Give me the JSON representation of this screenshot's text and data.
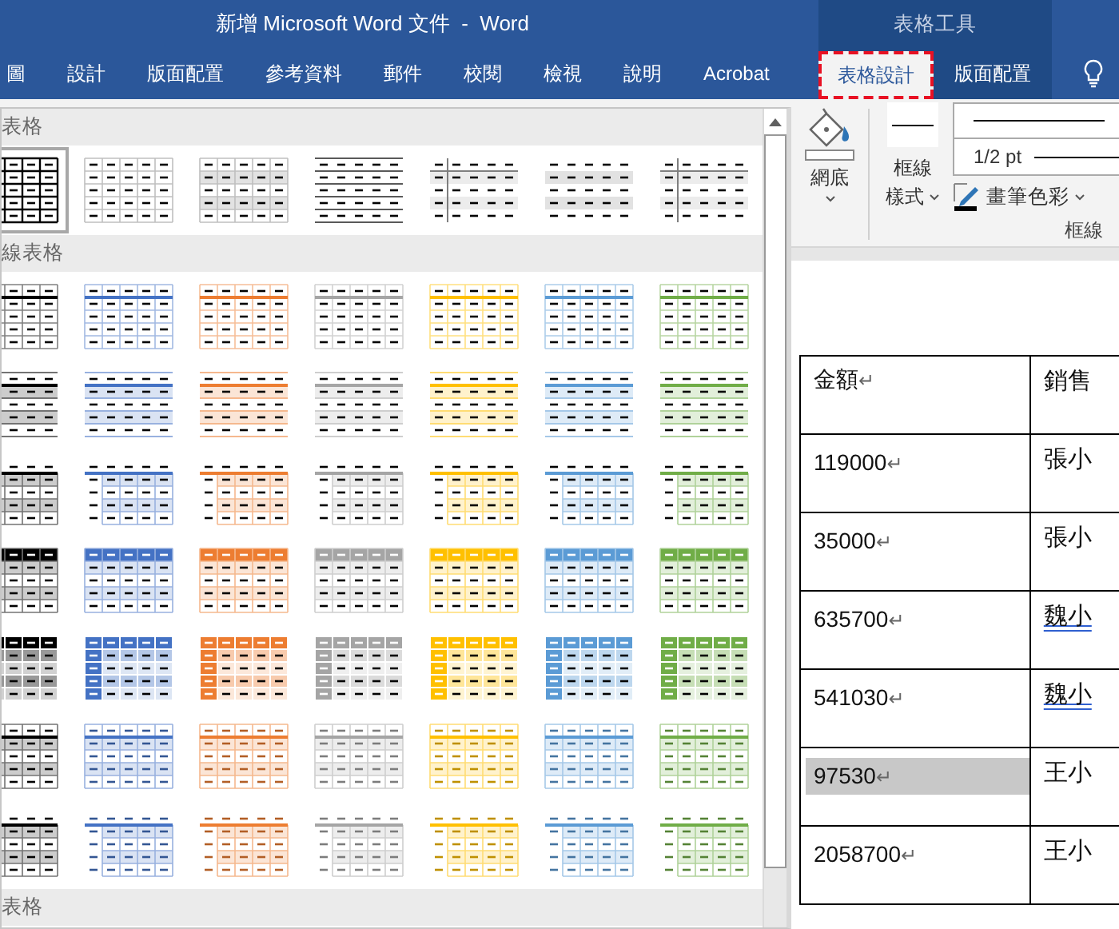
{
  "window": {
    "title": "新增 Microsoft Word 文件  -  Word"
  },
  "ribbon_tabs": [
    {
      "label": "圖",
      "selected": false
    },
    {
      "label": "設計",
      "selected": false
    },
    {
      "label": "版面配置",
      "selected": false
    },
    {
      "label": "參考資料",
      "selected": false
    },
    {
      "label": "郵件",
      "selected": false
    },
    {
      "label": "校閱",
      "selected": false
    },
    {
      "label": "檢視",
      "selected": false
    },
    {
      "label": "說明",
      "selected": false
    },
    {
      "label": "Acrobat",
      "selected": false
    }
  ],
  "contextual_group": {
    "label": "表格工具",
    "tabs": [
      {
        "label": "表格設計",
        "selected": true
      },
      {
        "label": "版面配置",
        "selected": false
      }
    ]
  },
  "gallery": {
    "sections": [
      {
        "label": "表格",
        "rows": [
          {
            "items": [
              {
                "kind": "grid-bold",
                "selected": true
              },
              {
                "kind": "grid",
                "selected": false
              },
              {
                "kind": "grid-banded",
                "selected": false
              },
              {
                "kind": "lines",
                "selected": false
              },
              {
                "kind": "plain-header-col",
                "selected": false
              },
              {
                "kind": "plain-banded",
                "selected": false
              },
              {
                "kind": "plain-header-col",
                "selected": false
              }
            ]
          }
        ]
      },
      {
        "label": "線表格",
        "rows": [
          {
            "kind": "light",
            "items": [
              {
                "color": "#000000",
                "selected": false
              },
              {
                "color": "#4472c4",
                "selected": false
              },
              {
                "color": "#ed7d31",
                "selected": false
              },
              {
                "color": "#a5a5a5",
                "selected": false
              },
              {
                "color": "#ffc000",
                "selected": false
              },
              {
                "color": "#5b9bd5",
                "selected": false
              },
              {
                "color": "#70ad47",
                "selected": false
              }
            ]
          },
          {
            "kind": "banded",
            "items": [
              {
                "color": "#000000",
                "selected": false
              },
              {
                "color": "#4472c4",
                "selected": false
              },
              {
                "color": "#ed7d31",
                "selected": false
              },
              {
                "color": "#a5a5a5",
                "selected": false
              },
              {
                "color": "#ffc000",
                "selected": false
              },
              {
                "color": "#5b9bd5",
                "selected": false
              },
              {
                "color": "#70ad47",
                "selected": false
              }
            ]
          },
          {
            "kind": "open",
            "items": [
              {
                "color": "#000000",
                "selected": false
              },
              {
                "color": "#4472c4",
                "selected": false
              },
              {
                "color": "#ed7d31",
                "selected": false
              },
              {
                "color": "#a5a5a5",
                "selected": false
              },
              {
                "color": "#ffc000",
                "selected": false
              },
              {
                "color": "#5b9bd5",
                "selected": false
              },
              {
                "color": "#70ad47",
                "selected": false
              }
            ]
          },
          {
            "kind": "header",
            "items": [
              {
                "color": "#000000",
                "selected": false
              },
              {
                "color": "#4472c4",
                "selected": false
              },
              {
                "color": "#ed7d31",
                "selected": false
              },
              {
                "color": "#a5a5a5",
                "selected": false
              },
              {
                "color": "#ffc000",
                "selected": false
              },
              {
                "color": "#5b9bd5",
                "selected": false
              },
              {
                "color": "#70ad47",
                "selected": false
              }
            ]
          },
          {
            "kind": "dark",
            "items": [
              {
                "color": "#000000",
                "selected": false
              },
              {
                "color": "#4472c4",
                "selected": false
              },
              {
                "color": "#ed7d31",
                "selected": false
              },
              {
                "color": "#a5a5a5",
                "selected": false
              },
              {
                "color": "#ffc000",
                "selected": false
              },
              {
                "color": "#5b9bd5",
                "selected": false
              },
              {
                "color": "#70ad47",
                "selected": false
              }
            ]
          },
          {
            "kind": "colorful",
            "items": [
              {
                "color": "#000000",
                "selected": false
              },
              {
                "color": "#4472c4",
                "selected": false
              },
              {
                "color": "#ed7d31",
                "selected": false
              },
              {
                "color": "#a5a5a5",
                "selected": false
              },
              {
                "color": "#ffc000",
                "selected": false
              },
              {
                "color": "#5b9bd5",
                "selected": false
              },
              {
                "color": "#70ad47",
                "selected": false
              }
            ]
          },
          {
            "kind": "colorful-open",
            "items": [
              {
                "color": "#000000",
                "selected": false
              },
              {
                "color": "#4472c4",
                "selected": false
              },
              {
                "color": "#ed7d31",
                "selected": false
              },
              {
                "color": "#a5a5a5",
                "selected": false
              },
              {
                "color": "#ffc000",
                "selected": false
              },
              {
                "color": "#5b9bd5",
                "selected": false
              },
              {
                "color": "#70ad47",
                "selected": false
              }
            ]
          }
        ]
      },
      {
        "label": "表格"
      }
    ]
  },
  "ribbon": {
    "shading": {
      "label": "網底"
    },
    "border_styles": {
      "lines": [
        "框線",
        "樣式"
      ]
    },
    "pen_weight": {
      "value": "1/2 pt"
    },
    "pen_color": {
      "label": "畫筆色彩"
    },
    "group_label": "框線"
  },
  "document_table": {
    "columns": [
      {
        "text": "金額",
        "mark": "↵"
      },
      {
        "text": "銷售"
      }
    ],
    "rows": [
      {
        "amount": "119000",
        "mark": "↵",
        "seller": "張小",
        "shaded": false,
        "flagged": false
      },
      {
        "amount": "35000",
        "mark": "↵",
        "seller": "張小",
        "shaded": false,
        "flagged": false
      },
      {
        "amount": "635700",
        "mark": "↵",
        "seller": "魏小",
        "shaded": false,
        "flagged": true
      },
      {
        "amount": "541030",
        "mark": "↵",
        "seller": "魏小",
        "shaded": false,
        "flagged": true
      },
      {
        "amount": "97530",
        "mark": "↵",
        "seller": "王小",
        "shaded": true,
        "flagged": false
      },
      {
        "amount": "2058700",
        "mark": "↵",
        "seller": "王小",
        "shaded": false,
        "flagged": false
      }
    ]
  }
}
